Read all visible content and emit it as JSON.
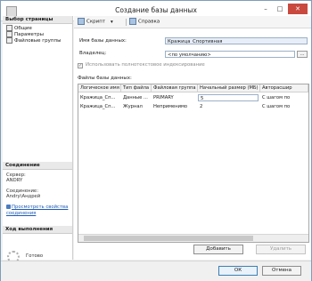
{
  "window": {
    "title": "Создание базы данных",
    "min_glyph": "–",
    "max_glyph": "□",
    "close_glyph": "✕"
  },
  "left_pane": {
    "pages_header": "Выбор страницы",
    "pages": [
      {
        "label": "Общие",
        "icon": "page-icon"
      },
      {
        "label": "Параметры",
        "icon": "page-icon"
      },
      {
        "label": "Файловые группы",
        "icon": "page-icon"
      }
    ],
    "connection_header": "Соединение",
    "server_label": "Сервер:",
    "server_value": "ANDRY",
    "connection_label": "Соединение:",
    "connection_value": "Andry\\Андрей",
    "link": "Просмотреть свойства соединения",
    "progress_header": "Ход выполнения",
    "progress_status": "Готово"
  },
  "toolbar": {
    "script_label": "Скрипт",
    "help_label": "Справка"
  },
  "form": {
    "db_name_label": "Имя базы данных:",
    "db_name_value": "Кражица_Спортивная",
    "owner_label": "Владелец:",
    "owner_value": "<по умолчанию>",
    "browse_label": "...",
    "fulltext_label": "Использовать полнотекстовое индексирование",
    "fulltext_checked": true,
    "files_label": "Файлы базы данных:"
  },
  "grid": {
    "columns": [
      "Логическое имя",
      "Тип файла",
      "Файловая группа",
      "Начальный размер (МБ)",
      "Авторасшир"
    ],
    "rows": [
      [
        "Кражица_Сп...",
        "Данные ...",
        "PRIMARY",
        "5",
        "С шагом по"
      ],
      [
        "Кражица_Сп...",
        "Журнал",
        "Неприменимо",
        "2",
        "С шагом по"
      ]
    ]
  },
  "buttons": {
    "add": "Добавить",
    "remove": "Удалить",
    "ok": "ОК",
    "cancel": "Отмена"
  }
}
